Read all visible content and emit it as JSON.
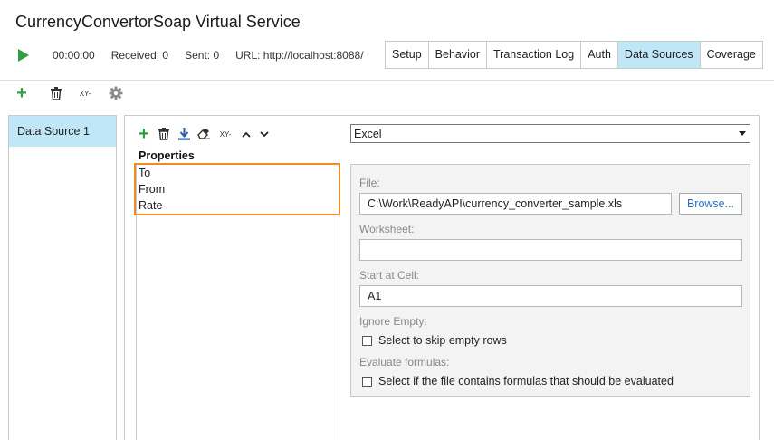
{
  "window": {
    "title": "CurrencyConvertorSoap Virtual Service"
  },
  "status": {
    "elapsed": "00:00:00",
    "received": "Received: 0",
    "sent": "Sent: 0",
    "url": "URL: http://localhost:8088/"
  },
  "tabs": [
    {
      "label": "Setup",
      "active": false
    },
    {
      "label": "Behavior",
      "active": false
    },
    {
      "label": "Transaction Log",
      "active": false
    },
    {
      "label": "Auth",
      "active": false
    },
    {
      "label": "Data Sources",
      "active": true
    },
    {
      "label": "Coverage",
      "active": false
    }
  ],
  "toolbar": {
    "xy_label": "XY-"
  },
  "data_sources": [
    {
      "label": "Data Source 1"
    }
  ],
  "properties": {
    "heading": "Properties",
    "xy_label": "XY-",
    "items": [
      "To",
      "From",
      "Rate"
    ]
  },
  "source_type": {
    "selected": "Excel"
  },
  "settings": {
    "file_label": "File:",
    "file_value": "C:\\Work\\ReadyAPI\\currency_converter_sample.xls",
    "browse_label": "Browse...",
    "worksheet_label": "Worksheet:",
    "worksheet_value": "",
    "start_cell_label": "Start at Cell:",
    "start_cell_value": "A1",
    "ignore_empty_label": "Ignore Empty:",
    "ignore_empty_checkbox": "Select to skip empty rows",
    "evaluate_label": "Evaluate formulas:",
    "evaluate_checkbox": "Select if the file contains formulas that should be evaluated"
  },
  "colors": {
    "accent_tab": "#bfe7f7",
    "play_green": "#2ea043",
    "highlight_orange": "#f08a24",
    "link_blue": "#2a6ebb"
  },
  "icons": [
    "play-icon",
    "plus-icon",
    "trash-icon",
    "xy-icon",
    "gear-icon",
    "download-icon",
    "eraser-icon",
    "chevron-up-icon",
    "chevron-down-icon",
    "dropdown-arrow-icon"
  ]
}
